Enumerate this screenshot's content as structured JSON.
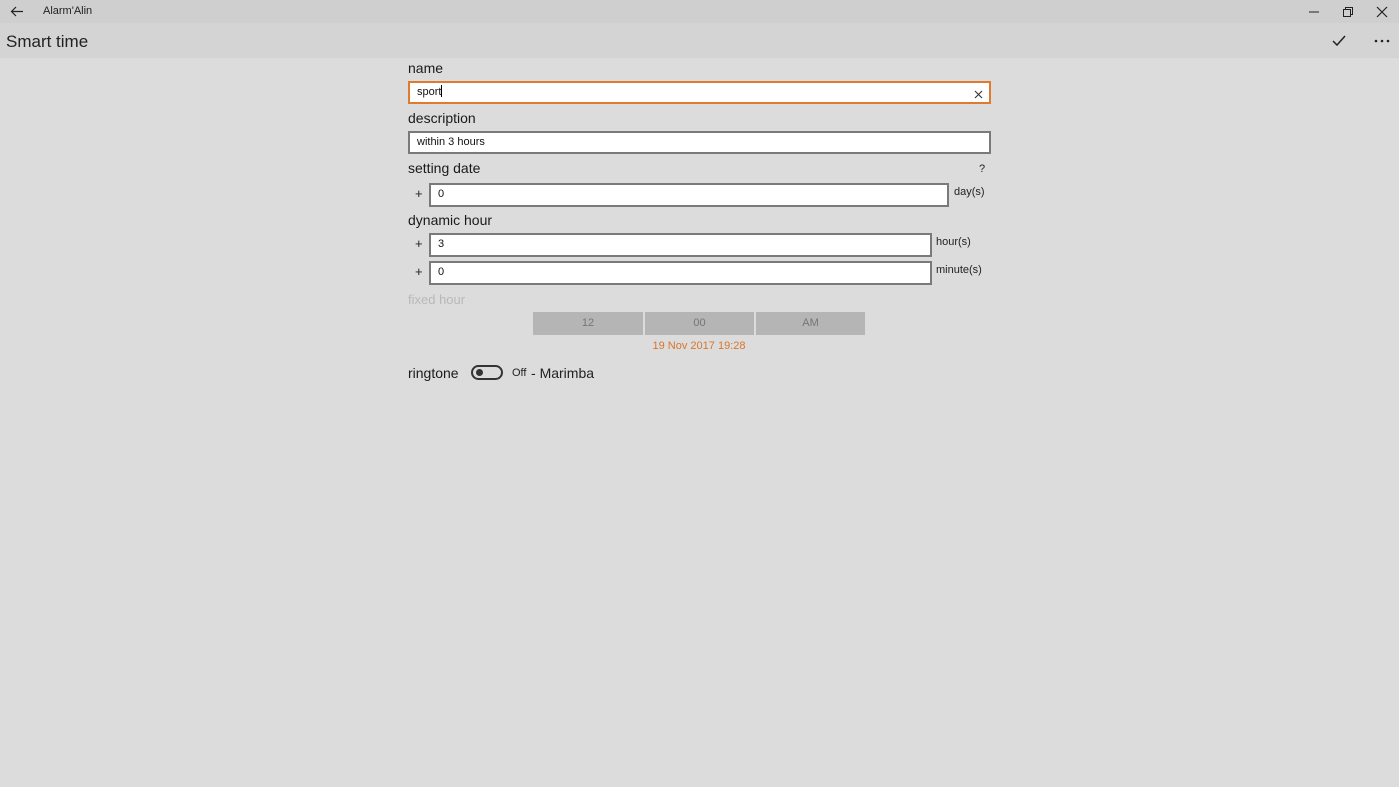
{
  "window": {
    "title": "Alarm'Alin"
  },
  "page": {
    "title": "Smart time"
  },
  "form": {
    "name_label": "name",
    "name_value": "sport",
    "description_label": "description",
    "description_value": "within 3 hours",
    "setting_date_label": "setting date",
    "help_glyph": "?",
    "plus": "+",
    "days_value": "0",
    "days_unit": "day(s)",
    "dynamic_hour_label": "dynamic hour",
    "hours_value": "3",
    "hours_unit": "hour(s)",
    "minutes_value": "0",
    "minutes_unit": "minute(s)",
    "fixed_hour_label": "fixed hour",
    "fixed_hour": {
      "hour": "12",
      "minute": "00",
      "period": "AM"
    },
    "computed_datetime": "19 Nov 2017 19:28",
    "ringtone_label": "ringtone",
    "ringtone_toggle_state": "Off",
    "ringtone_separator": "-",
    "ringtone_name": "Marimba"
  },
  "colors": {
    "accent": "#e07a2e",
    "computed_text": "#d9752c",
    "background": "#dcdcdc"
  }
}
